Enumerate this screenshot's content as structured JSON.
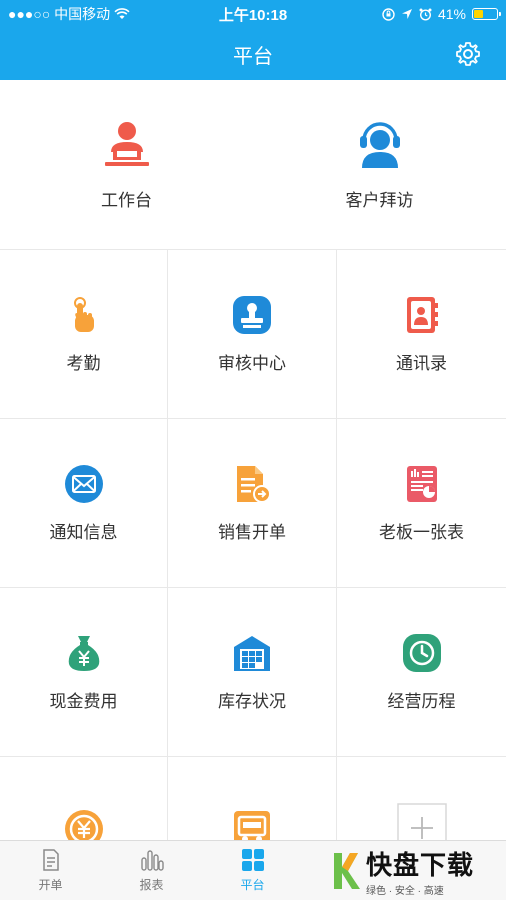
{
  "status_bar": {
    "carrier": "●●●○○ 中国移动",
    "time": "上午10:18",
    "battery": "41%",
    "battery_level": 0.41
  },
  "header": {
    "title": "平台"
  },
  "top_items": [
    {
      "label": "工作台",
      "icon": "workstation-icon"
    },
    {
      "label": "客户拜访",
      "icon": "customer-visit-icon"
    }
  ],
  "grid_items": [
    {
      "label": "考勤",
      "icon": "attendance-icon"
    },
    {
      "label": "审核中心",
      "icon": "audit-center-icon"
    },
    {
      "label": "通讯录",
      "icon": "contacts-icon"
    },
    {
      "label": "通知信息",
      "icon": "notification-icon"
    },
    {
      "label": "销售开单",
      "icon": "sales-order-icon"
    },
    {
      "label": "老板一张表",
      "icon": "boss-report-icon"
    },
    {
      "label": "现金费用",
      "icon": "cash-expense-icon"
    },
    {
      "label": "库存状况",
      "icon": "inventory-icon"
    },
    {
      "label": "经营历程",
      "icon": "business-history-icon"
    },
    {
      "label": "",
      "icon": "yuan-coin-icon"
    },
    {
      "label": "",
      "icon": "truck-icon"
    },
    {
      "label": "",
      "icon": "add-icon"
    }
  ],
  "tabs": [
    {
      "label": "开单",
      "icon": "document-icon"
    },
    {
      "label": "报表",
      "icon": "bar-chart-icon"
    },
    {
      "label": "平台",
      "icon": "grid-icon",
      "active": true
    }
  ],
  "watermark": {
    "title": "快盘下载",
    "subtitle": "绿色 · 安全 · 高速"
  },
  "colors": {
    "primary": "#1aa7ec",
    "red": "#ef5b4b",
    "orange": "#f7a23a",
    "blue": "#1f8ad8",
    "green": "#2fa27a",
    "pink": "#ea5a67"
  }
}
